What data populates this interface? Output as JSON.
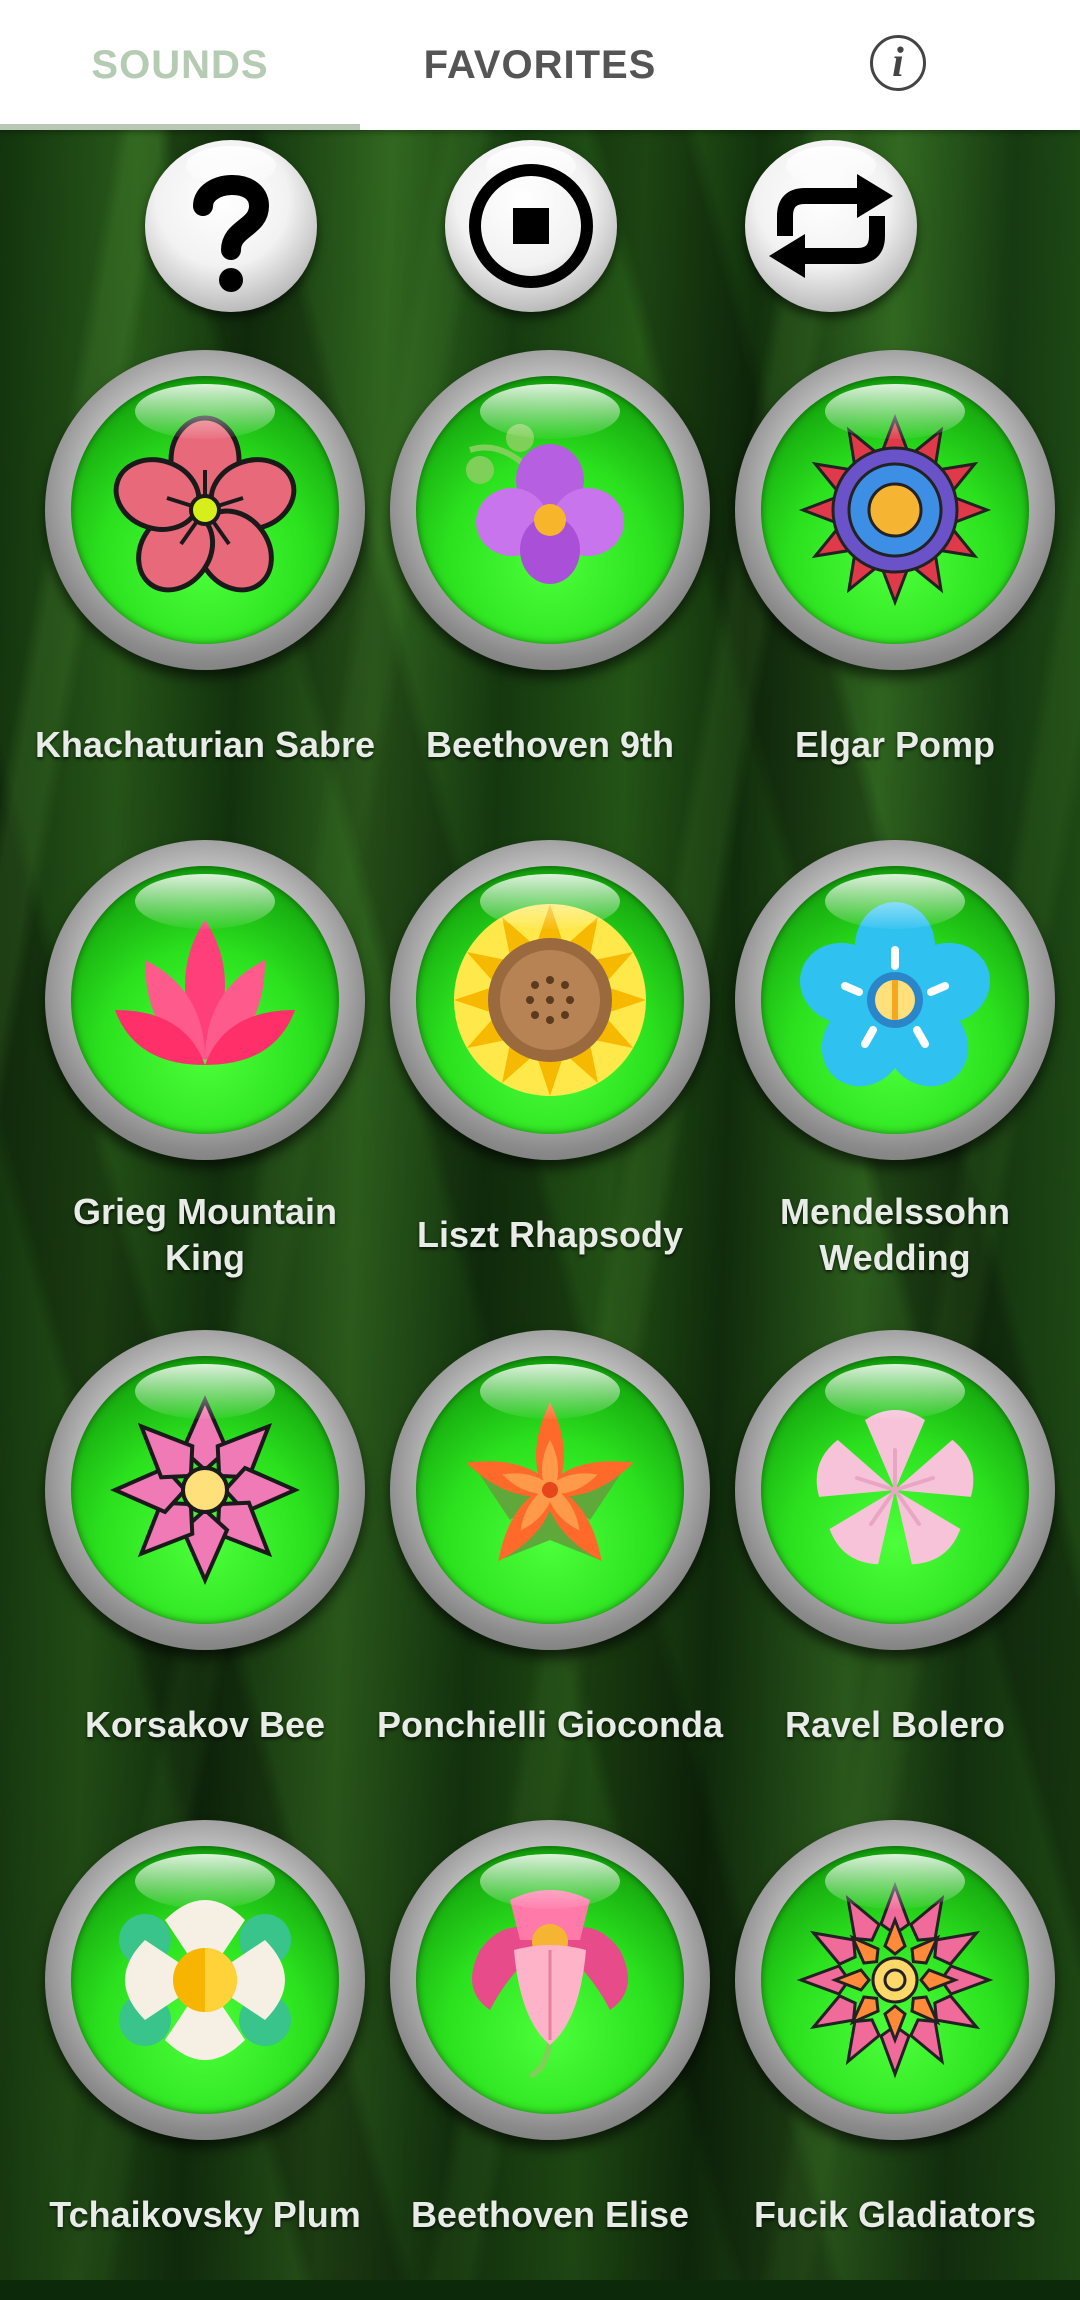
{
  "tabs": {
    "sounds": "SOUNDS",
    "favorites": "FAVORITES",
    "active": "SOUNDS"
  },
  "info_icon": "info-icon",
  "controls": [
    {
      "name": "help",
      "icon": "question-mark-icon"
    },
    {
      "name": "stop",
      "icon": "stop-icon"
    },
    {
      "name": "repeat",
      "icon": "repeat-icon"
    }
  ],
  "sounds": [
    {
      "label": "Khachaturian Sabre",
      "icon": "pink-flower-icon"
    },
    {
      "label": "Beethoven 9th",
      "icon": "purple-orchid-icon"
    },
    {
      "label": "Elgar Pomp",
      "icon": "mandala-flower-icon"
    },
    {
      "label": "Grieg Mountain King",
      "icon": "lotus-icon"
    },
    {
      "label": "Liszt Rhapsody",
      "icon": "sunflower-icon"
    },
    {
      "label": "Mendelssohn Wedding",
      "icon": "blue-flower-icon"
    },
    {
      "label": "Korsakov Bee",
      "icon": "pink-dahlia-icon"
    },
    {
      "label": "Ponchielli Gioconda",
      "icon": "orange-lily-icon"
    },
    {
      "label": "Ravel Bolero",
      "icon": "cherry-blossom-icon"
    },
    {
      "label": "Tchaikovsky Plum",
      "icon": "white-plum-flower-icon"
    },
    {
      "label": "Beethoven Elise",
      "icon": "pink-bell-flower-icon"
    },
    {
      "label": "Fucik Gladiators",
      "icon": "pink-chrysanthemum-icon"
    }
  ],
  "colors": {
    "button_green": "#2be11e",
    "tab_active": "#b5cbb3",
    "tab_inactive": "#555555",
    "label_text": "#e8ece6"
  }
}
